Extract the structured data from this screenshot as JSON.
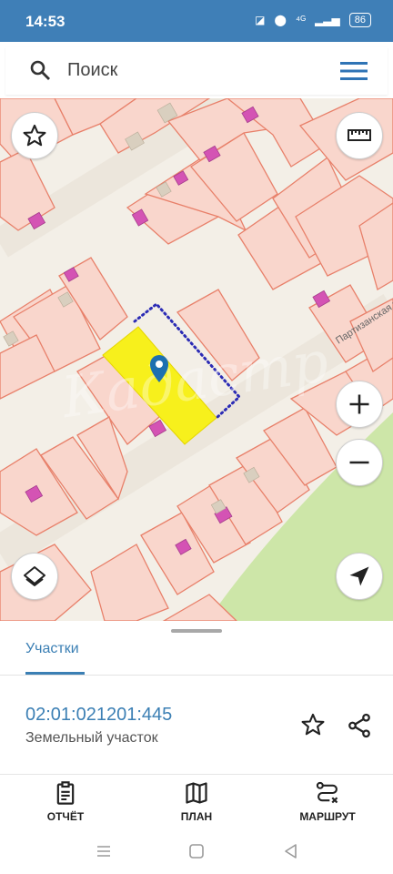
{
  "status_bar": {
    "time": "14:53",
    "network_label": "⁴ᴳ",
    "battery": "86"
  },
  "search": {
    "placeholder": "Поиск"
  },
  "map": {
    "street_label": "Партизанская ул",
    "watermark": "Кадастр",
    "colors": {
      "background": "#f3efe7",
      "parcel_fill": "#f9d6cc",
      "parcel_border": "#e8806a",
      "building": "#d453b4",
      "selected_parcel": "#f7f01c",
      "green_area": "#cde6a8",
      "marker": "#1d6fb0"
    }
  },
  "sheet": {
    "tab_label": "Участки",
    "parcel_number": "02:01:021201:445",
    "parcel_type": "Земельный участок"
  },
  "bottom_nav": {
    "report_label": "ОТЧЁТ",
    "plan_label": "ПЛАН",
    "route_label": "МАРШРУТ"
  },
  "icons": [
    "search-icon",
    "menu-icon",
    "star-icon",
    "ruler-icon",
    "layers-icon",
    "zoom-in-icon",
    "zoom-out-icon",
    "location-arrow-icon",
    "share-icon",
    "report-icon",
    "map-icon",
    "route-icon"
  ]
}
